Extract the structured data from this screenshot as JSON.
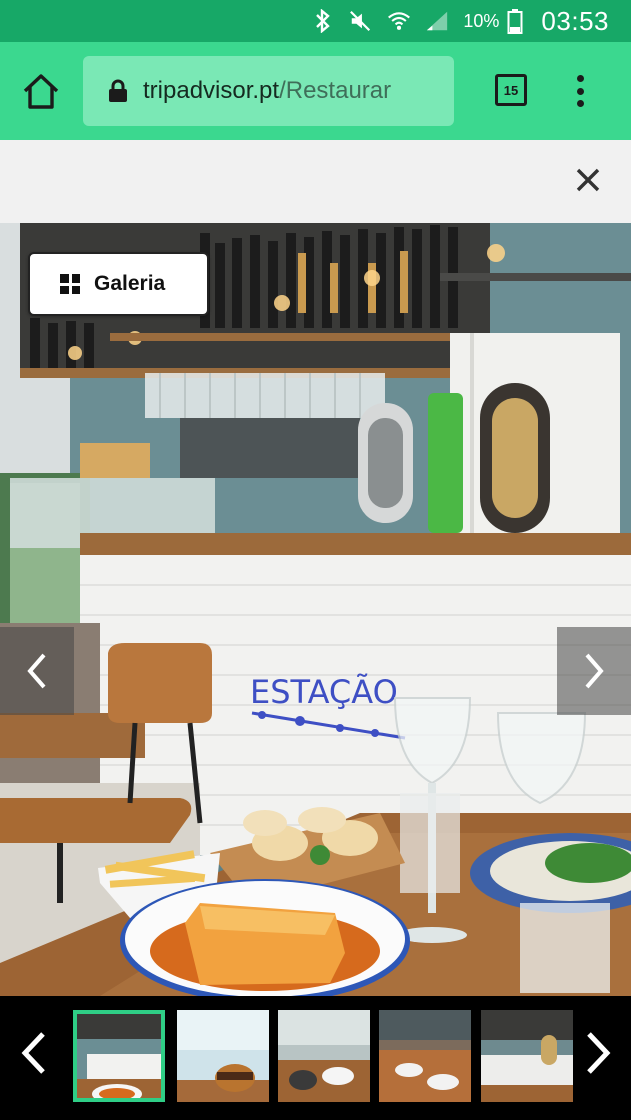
{
  "status_bar": {
    "battery_percent": "10%",
    "time": "03:53"
  },
  "browser": {
    "url_domain": "tripadvisor.pt",
    "url_path": "/Restaurar",
    "tab_count": "15"
  },
  "gallery": {
    "button_label": "Galeria",
    "sign_text": "ESTAÇÃO",
    "thumbnails": [
      {
        "name": "thumbnail-1",
        "active": true
      },
      {
        "name": "thumbnail-2",
        "active": false
      },
      {
        "name": "thumbnail-3",
        "active": false
      },
      {
        "name": "thumbnail-4",
        "active": false
      },
      {
        "name": "thumbnail-5",
        "active": false
      }
    ]
  },
  "colors": {
    "status_bar": "#17a867",
    "browser_bar": "#3bd88f",
    "url_box": "#7ae8b5",
    "active_thumb_border": "#2fce86"
  }
}
